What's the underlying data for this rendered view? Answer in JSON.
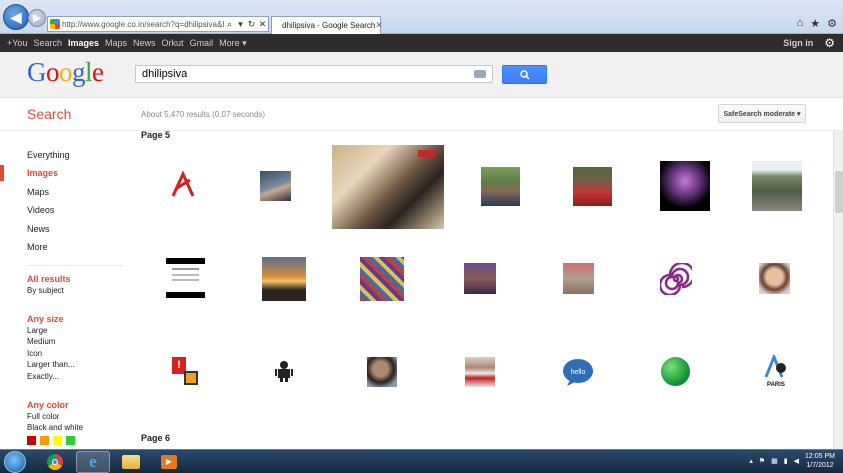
{
  "browser": {
    "address_url": "http://www.google.co.in/search?q=dhilipsiva&hl=",
    "tab_title": "dhilipsiva - Google Search"
  },
  "gbar": {
    "links": [
      "+You",
      "Search",
      "Images",
      "Maps",
      "News",
      "Orkut",
      "Gmail",
      "More ▾"
    ],
    "active": "Images",
    "sign_in": "Sign in"
  },
  "search": {
    "query": "dhilipsiva",
    "section_title": "Search",
    "result_stats": "About 5,470 results (0.07 seconds)",
    "safesearch": "SafeSearch moderate ▾"
  },
  "logo": {
    "text": "Google"
  },
  "leftnav": {
    "types": [
      "Everything",
      "Images",
      "Maps",
      "Videos",
      "News",
      "More"
    ],
    "active_type": "Images",
    "results_filter": [
      "All results",
      "By subject"
    ],
    "size_filter": [
      "Any size",
      "Large",
      "Medium",
      "Icon",
      "Larger than...",
      "Exactly..."
    ],
    "color_filter": [
      "Any color",
      "Full color",
      "Black and white"
    ],
    "color_swatches": [
      "#cc0000",
      "#ff9900",
      "#ffff00",
      "#33cc33"
    ]
  },
  "results": {
    "page_label_top": "Page 5",
    "page_label_bottom": "Page 6"
  },
  "taskbar": {
    "time": "12:05 PM",
    "date": "1/7/2012"
  },
  "colors": {
    "google_red": "#dd4b39",
    "search_button": "#4d90fe",
    "gbar_bg": "#2d2d2d"
  }
}
